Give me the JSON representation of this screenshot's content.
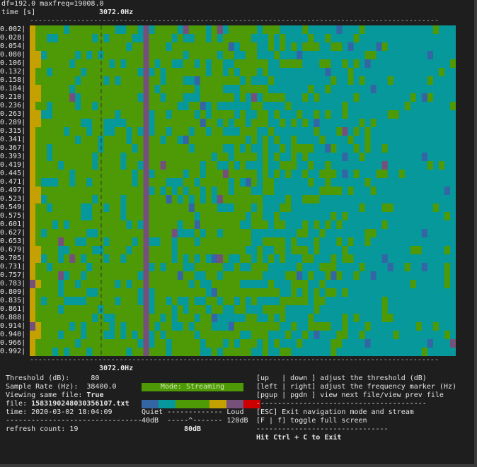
{
  "header": {
    "params": "df=192.0 maxfreq=19008.0",
    "time_label": "time [s]",
    "marker_top": "3072.0Hz",
    "marker_bottom": "3072.0Hz"
  },
  "dotted_line": "------------------------------------------------------------------------------------------------",
  "time_ticks": [
    "0.002|",
    "0.028|",
    "0.054|",
    "0.080|",
    "0.106|",
    "0.132|",
    "0.158|",
    "0.184|",
    "0.210|",
    "0.236|",
    "0.263|",
    "0.289|",
    "0.315|",
    "0.341|",
    "0.367|",
    "0.393|",
    "0.419|",
    "0.445|",
    "0.471|",
    "0.497|",
    "0.523|",
    "0.549|",
    "0.575|",
    "0.601|",
    "0.627|",
    "0.653|",
    "0.679|",
    "0.705|",
    "0.731|",
    "0.757|",
    "0.783|",
    "0.809|",
    "0.835|",
    "0.861|",
    "0.888|",
    "0.914|",
    "0.940|",
    "0.966|",
    "0.992|"
  ],
  "status": {
    "threshold": "Threshold (dB):     80",
    "sample_rate": "Sample Rate (Hz):  38400.0",
    "viewing_same_label": "Viewing same file: ",
    "viewing_same_value": "True",
    "file_label": "file: ",
    "file_value": "1583190248030356107.txt",
    "time": "time: 2020-03-02 18:04:09",
    "separator": "--------------------------------",
    "refresh": "refresh count: 19"
  },
  "mode": {
    "label": "Mode: Streaming",
    "color": "#4e9a06"
  },
  "legend": {
    "colors": [
      "#3465a4",
      "#06989a",
      "#4e9a06",
      "#4e9a06",
      "#c4a000",
      "#75507b",
      "#cc0000"
    ],
    "quiet": "Quiet ------------- Loud",
    "scale": "40dB  -----^------- 120dB",
    "marker_value": "80dB"
  },
  "help": {
    "line1": "[up   | down ] adjust the threshold (dB)",
    "line2": "[left | right] adjust the frequency marker (Hz)",
    "line3": "[pgup | pgdn ] view next file/view prev file",
    "sep1": "----------------------------------------",
    "line4": "[ESC] Exit navigation mode and stream",
    "line5": "[F | f] toggle full screen",
    "sep2": "-------------------------------",
    "exit": "Hit Ctrl + C to Exit"
  },
  "palette": {
    "green": "#4e9a06",
    "cyan": "#06989a",
    "yellow": "#c4a000",
    "purple": "#75507b",
    "blue": "#3465a4",
    "red": "#cc0000"
  }
}
